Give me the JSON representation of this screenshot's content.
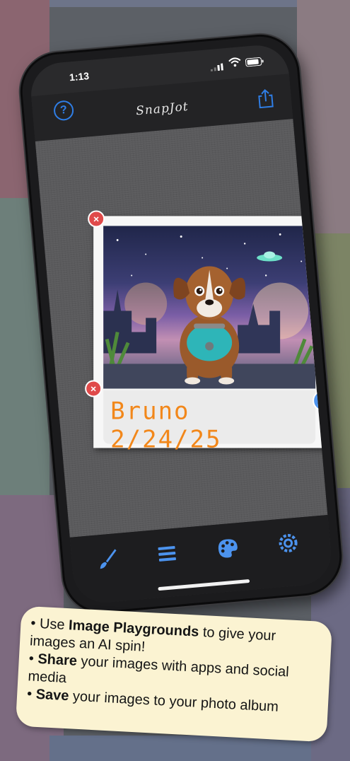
{
  "status_bar": {
    "time": "1:13"
  },
  "header": {
    "title": "SnapJot",
    "help_icon": "question-circle-icon",
    "share_icon": "share-icon"
  },
  "note": {
    "caption": "Bruno 2/24/25",
    "caption_color": "#f2871a",
    "photo_subject": "cartoon dog in teal harness under starry sky"
  },
  "tab_bar": {
    "items": [
      {
        "icon": "paintbrush-icon"
      },
      {
        "icon": "lines-menu-icon"
      },
      {
        "icon": "palette-icon"
      },
      {
        "icon": "settings-icon"
      }
    ],
    "accent": "#4c93ee"
  },
  "info_card": {
    "bullets": [
      {
        "prefix": "• Use ",
        "bold": "Image Playgrounds",
        "rest": " to give your images an AI spin!"
      },
      {
        "prefix": "• ",
        "bold": "Share",
        "rest": " your images with apps and social media"
      },
      {
        "prefix": "• ",
        "bold": "Save",
        "rest": " your images to your photo album"
      }
    ],
    "background": "#fbf3d2"
  }
}
